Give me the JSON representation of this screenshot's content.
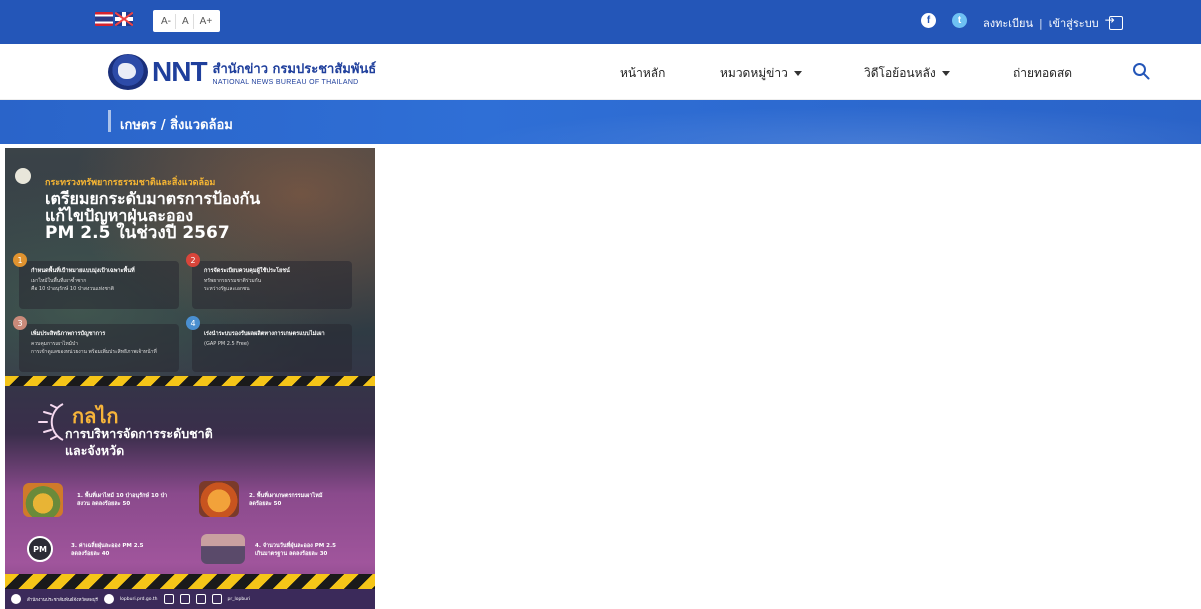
{
  "topbar": {
    "font_sizes": [
      "A-",
      "A",
      "A+"
    ],
    "register_label": "ลงทะเบียน",
    "separator": "|",
    "login_label": "เข้าสู่ระบบ",
    "facebook_glyph": "f",
    "twitter_glyph": "t"
  },
  "logo": {
    "brand": "NNT",
    "thai_name": "สำนักข่าว กรมประชาสัมพันธ์",
    "english_name": "NATIONAL NEWS BUREAU OF THAILAND"
  },
  "nav": {
    "items": [
      {
        "label": "หน้าหลัก",
        "dropdown": false
      },
      {
        "label": "หมวดหมู่ข่าว",
        "dropdown": true
      },
      {
        "label": "วิดีโอย้อนหลัง",
        "dropdown": true
      },
      {
        "label": "ถ่ายทอดสด",
        "dropdown": false
      }
    ]
  },
  "breadcrumb": "เกษตร / สิ่งแวดล้อม",
  "poster": {
    "ministry": "กระทรวงทรัพยากรธรรมชาติและสิ่งแวดล้อม",
    "title_line1": "เตรียมยกระดับมาตรการป้องกัน",
    "title_line2": "แก้ไขปัญหาฝุ่นละออง",
    "title_line3": "PM 2.5 ในช่วงปี 2567",
    "cards": [
      {
        "num": "1",
        "head": "กำหนดพื้นที่เป้าหมายแบบมุ่งเป้าเฉพาะพื้นที่",
        "body1": "เผาไหม้ในพื้นที่เผาซ้ำซาก",
        "body2": "คือ 10 ป่าอนุรักษ์ 10 ป่าสงวนแห่งชาติ"
      },
      {
        "num": "2",
        "head": "การจัดระเบียบควบคุมผู้ใช้ประโยชน์",
        "body1": "ทรัพยากรธรรมชาติร่วมกัน",
        "body2": "ระหว่างรัฐและเอกชน"
      },
      {
        "num": "3",
        "head": "เพิ่มประสิทธิภาพการบัญชาการ",
        "body1": "ควบคุมการเผาไหม้ป่า",
        "body2": "การเข้าดูแลของหน่วยงาน พร้อมเพิ่มประสิทธิภาพเจ้าหน้าที่"
      },
      {
        "num": "4",
        "head": "เร่งนำระบบรองรับผลผลิตทางการเกษตรแบบไม่เผา",
        "body1": "(GAP PM 2.5 Free)",
        "body2": ""
      }
    ],
    "mechanism_title": "กลไก",
    "mechanism_sub1": "การบริหารจัดการระดับชาติ",
    "mechanism_sub2": "และจังหวัด",
    "items": [
      {
        "line1": "1. พื้นที่เผาไหม้ 10 ป่าอนุรักษ์ 10 ป่า",
        "line2": "สงวน ลดลงร้อยละ 50"
      },
      {
        "line1": "2. พื้นที่เผาเกษตรกรรมเผาไหม้",
        "line2": "ลดร้อยละ 50"
      },
      {
        "line1": "3. ค่าเฉลี่ยฝุ่นละออง PM 2.5",
        "line2": "ลดลงร้อยละ 40"
      },
      {
        "line1": "4. จำนวนวันที่ฝุ่นละออง PM 2.5",
        "line2": "เกินมาตรฐาน ลดลงร้อยละ 30"
      }
    ],
    "pm_badge": "PM",
    "footer_page": "สำนักงานประชาสัมพันธ์จังหวัดลพบุรี",
    "footer_site": "lopburi.prd.go.th",
    "footer_handle": "pr_lopburi"
  },
  "colors": {
    "topbar": "#2456b8",
    "band": "#2f6fd6",
    "brand_blue": "#1f3f9c",
    "poster_accent": "#f6b43a"
  }
}
